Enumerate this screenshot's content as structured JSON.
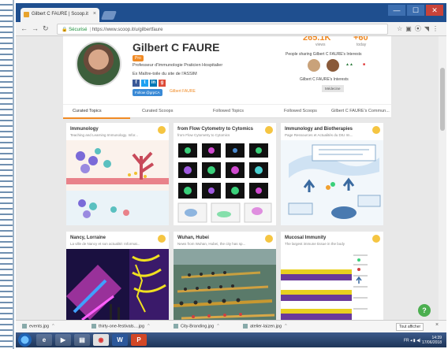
{
  "browser": {
    "tab_title": "Gilbert C FAURE | Scoop.it",
    "tab_close": "×",
    "url_secure_label": "Sécurisé",
    "url": "https://www.scoop.it/u/gilbertfaure",
    "win_minimize": "—",
    "win_maximize": "☐",
    "win_close": "✕"
  },
  "profile": {
    "name": "Gilbert C FAURE",
    "badge": "Pro",
    "title": "Professeur d'Immunologie Praticien Hospitalier",
    "subtitle": "Ex Maître-toile du site de l'ASSIM",
    "follow_button": "Follow @grpCA",
    "link_label": "Gilbert FAURE",
    "stats": [
      {
        "value": "265.1K",
        "label": "views"
      },
      {
        "value": "+60",
        "label": "today"
      }
    ],
    "sharing_label": "People sharing Gilbert C FAURE's Interests",
    "interests_label": "Gilbert C FAURE's Interests",
    "interest_tag": "Médecine"
  },
  "profile_tabs": [
    {
      "label": "Curated Topics"
    },
    {
      "label": "Curated Scoops"
    },
    {
      "label": "Followed Topics"
    },
    {
      "label": "Followed Scoops"
    },
    {
      "label": "Gilbert C FAURE's Commun..."
    }
  ],
  "cards": [
    {
      "title": "Immunology",
      "subtitle": "Teaching and Learning Immunology. Infor..."
    },
    {
      "title": "from Flow Cytometry to Cytomics",
      "subtitle": "from Flow Cytometry to Cytomics"
    },
    {
      "title": "Immunology and Biotherapies",
      "subtitle": "Page Ressources et Actualités du DIU Im..."
    },
    {
      "title": "Nancy, Lorraine",
      "subtitle": "La ville de Nancy et son actualité: Informat..."
    },
    {
      "title": "Wuhan, Hubei",
      "subtitle": "News from Wuhan, Hubei, the city has sp..."
    },
    {
      "title": "Mucosal Immunity",
      "subtitle": "The largest immune tissue in the body"
    }
  ],
  "downloads": [
    {
      "name": "events.jpg"
    },
    {
      "name": "thirty-one-festivals....jpg"
    },
    {
      "name": "City-Branding.jpg"
    },
    {
      "name": "atelier-laizen.jpg"
    }
  ],
  "download_show_all": "Tout afficher",
  "download_close": "×",
  "help_label": "?",
  "taskbar": {
    "tray_lang": "FR",
    "time": "14:39",
    "date": "17/06/2018"
  }
}
